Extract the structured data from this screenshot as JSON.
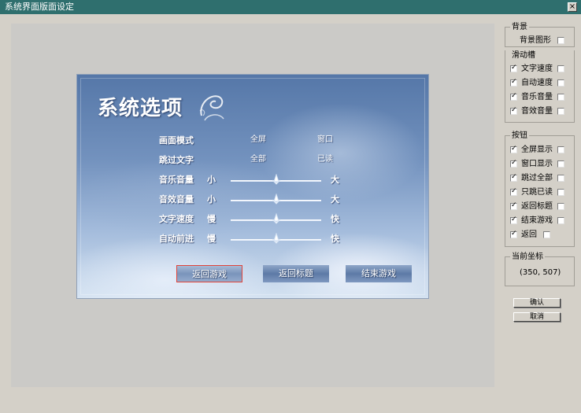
{
  "window": {
    "title": "系统界面版面设定",
    "close_glyph": "×"
  },
  "game": {
    "title": "系统选项",
    "options": [
      {
        "label": "画面模式",
        "values": [
          "全屏",
          "窗口"
        ]
      },
      {
        "label": "跳过文字",
        "values": [
          "全部",
          "已读"
        ]
      }
    ],
    "sliders": [
      {
        "label": "音乐音量",
        "min": "小",
        "max": "大",
        "level": 0.5
      },
      {
        "label": "音效音量",
        "min": "小",
        "max": "大",
        "level": 0.5
      },
      {
        "label": "文字速度",
        "min": "慢",
        "max": "快",
        "level": 0.5
      },
      {
        "label": "自动前进",
        "min": "慢",
        "max": "快",
        "level": 0.5
      }
    ],
    "buttons": [
      {
        "label": "返回游戏",
        "selected": true
      },
      {
        "label": "返回标题",
        "selected": false
      },
      {
        "label": "结束游戏",
        "selected": false
      }
    ]
  },
  "panels": {
    "background": {
      "label": "背景",
      "item": {
        "text": "背景图形",
        "checked": false
      }
    },
    "slider_group": {
      "label": "滑动槽",
      "items": [
        {
          "text": "文字速度",
          "left_checked": true,
          "right_checked": false
        },
        {
          "text": "自动速度",
          "left_checked": true,
          "right_checked": false
        },
        {
          "text": "音乐音量",
          "left_checked": true,
          "right_checked": false
        },
        {
          "text": "音效音量",
          "left_checked": true,
          "right_checked": false
        }
      ]
    },
    "buttons_group": {
      "label": "按钮",
      "items": [
        {
          "text": "全屏显示",
          "left_checked": true,
          "right_checked": false
        },
        {
          "text": "窗口显示",
          "left_checked": true,
          "right_checked": false
        },
        {
          "text": "跳过全部",
          "left_checked": true,
          "right_checked": false
        },
        {
          "text": "只跳已读",
          "left_checked": true,
          "right_checked": false
        },
        {
          "text": "返回标题",
          "left_checked": true,
          "right_checked": false
        },
        {
          "text": "结束游戏",
          "left_checked": true,
          "right_checked": false
        },
        {
          "text": "返回",
          "left_checked": true,
          "right_checked": false
        }
      ]
    },
    "coords": {
      "label": "当前坐标",
      "value": "(350, 507)"
    }
  },
  "actions": {
    "ok_label": "确认",
    "cancel_label": "取消"
  },
  "colors": {
    "titlebar": "#2f6f6e",
    "selected_border": "#e0443a",
    "game_top": "#5577a8",
    "game_bottom": "#d4e2f1"
  }
}
